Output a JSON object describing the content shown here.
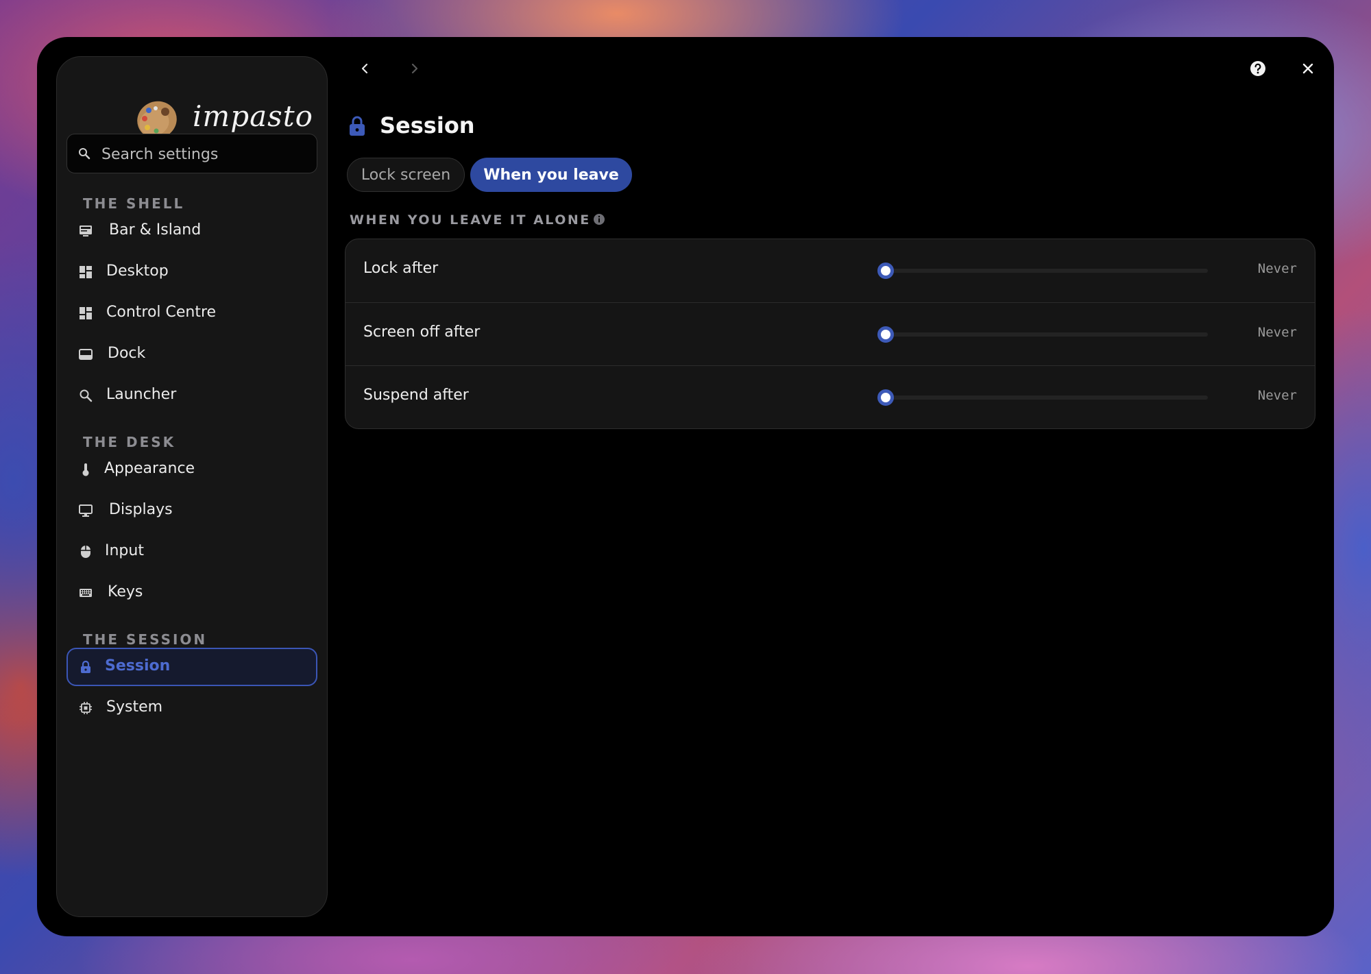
{
  "app": {
    "logo_text": "impasto"
  },
  "search": {
    "placeholder": "Search settings"
  },
  "sidebar": {
    "sections": [
      {
        "title": "THE SHELL",
        "items": [
          {
            "label": "Bar & Island",
            "icon": "monitor-bar-icon"
          },
          {
            "label": "Desktop",
            "icon": "grid-icon"
          },
          {
            "label": "Control Centre",
            "icon": "grid-icon"
          },
          {
            "label": "Dock",
            "icon": "dock-icon"
          },
          {
            "label": "Launcher",
            "icon": "search-icon"
          }
        ]
      },
      {
        "title": "THE DESK",
        "items": [
          {
            "label": "Appearance",
            "icon": "thermometer-icon"
          },
          {
            "label": "Displays",
            "icon": "monitor-icon"
          },
          {
            "label": "Input",
            "icon": "mouse-icon"
          },
          {
            "label": "Keys",
            "icon": "keyboard-icon"
          }
        ]
      },
      {
        "title": "THE SESSION",
        "items": [
          {
            "label": "Session",
            "icon": "lock-icon",
            "active": true
          },
          {
            "label": "System",
            "icon": "chip-icon"
          }
        ]
      }
    ]
  },
  "header": {
    "title": "Session",
    "tabs": [
      {
        "label": "Lock screen",
        "active": false
      },
      {
        "label": "When you leave",
        "active": true
      }
    ]
  },
  "group": {
    "title": "WHEN YOU LEAVE IT ALONE",
    "rows": [
      {
        "label": "Lock after",
        "value": "Never",
        "level": 0
      },
      {
        "label": "Screen off after",
        "value": "Never",
        "level": 0
      },
      {
        "label": "Suspend after",
        "value": "Never",
        "level": 0
      }
    ]
  },
  "colors": {
    "accent": "#3d5ab8",
    "active_text": "#4d6bd0",
    "background": "#000000",
    "panel": "#161616"
  }
}
